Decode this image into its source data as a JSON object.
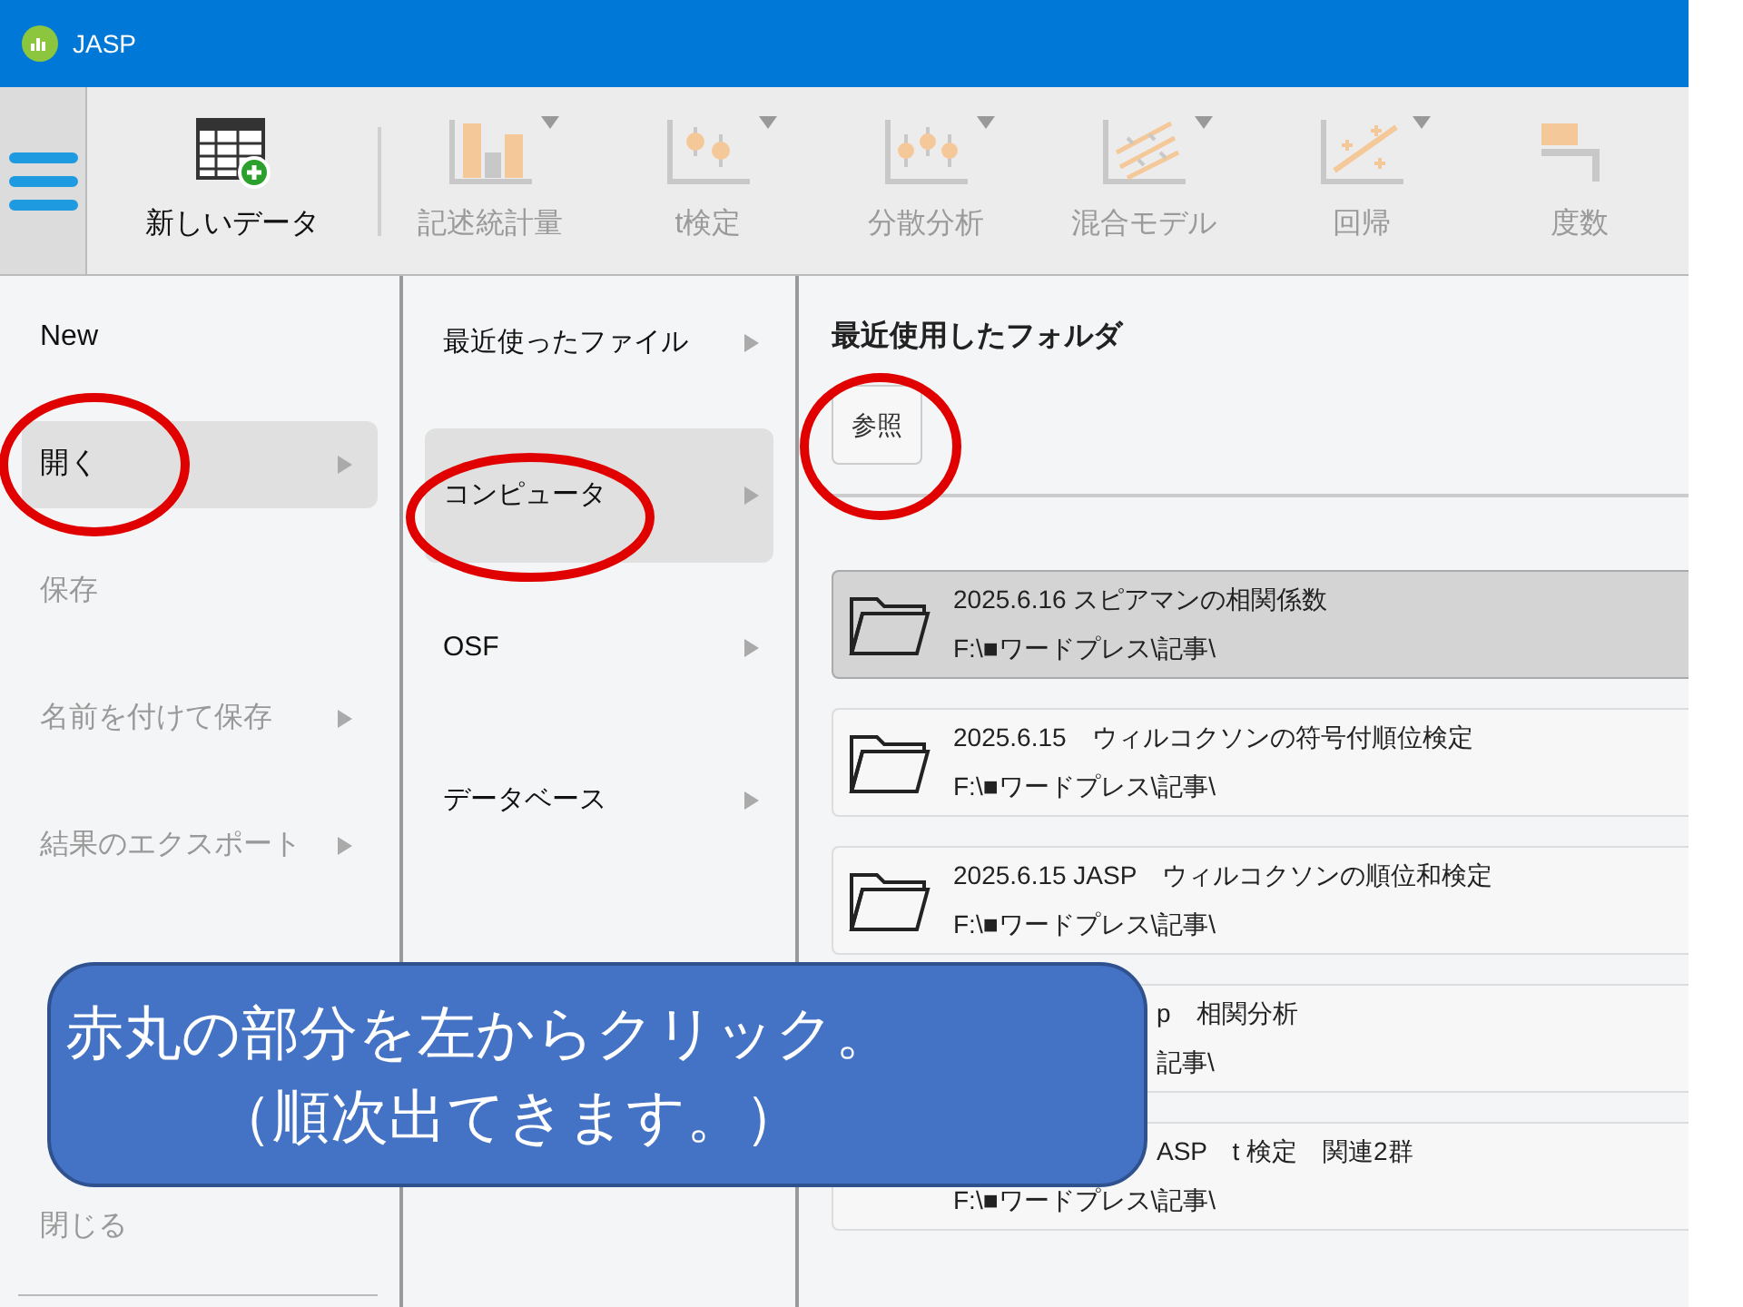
{
  "window": {
    "title": "JASP"
  },
  "toolbar": [
    {
      "label": "新しいデータ",
      "kind": "new",
      "disabled": false,
      "dropdown": false
    },
    {
      "label": "記述統計量",
      "kind": "bars",
      "disabled": true,
      "dropdown": true
    },
    {
      "label": "t検定",
      "kind": "ttest",
      "disabled": true,
      "dropdown": true
    },
    {
      "label": "分散分析",
      "kind": "anova",
      "disabled": true,
      "dropdown": true
    },
    {
      "label": "混合モデル",
      "kind": "mixed",
      "disabled": true,
      "dropdown": true
    },
    {
      "label": "回帰",
      "kind": "regression",
      "disabled": true,
      "dropdown": true
    },
    {
      "label": "度数",
      "kind": "freq",
      "disabled": true,
      "dropdown": false
    }
  ],
  "file_menu": [
    {
      "label": "New",
      "disabled": false,
      "submenu": false,
      "selected": false
    },
    {
      "label": "開く",
      "disabled": false,
      "submenu": true,
      "selected": true
    },
    {
      "label": "保存",
      "disabled": true,
      "submenu": false,
      "selected": false
    },
    {
      "label": "名前を付けて保存",
      "disabled": true,
      "submenu": true,
      "selected": false
    },
    {
      "label": "結果のエクスポート",
      "disabled": true,
      "submenu": true,
      "selected": false
    },
    {
      "label": "閉じる",
      "disabled": true,
      "submenu": false,
      "selected": false
    }
  ],
  "open_menu": [
    {
      "label": "最近使ったファイル",
      "selected": false
    },
    {
      "label": "コンピュータ",
      "selected": true
    },
    {
      "label": "OSF",
      "selected": false
    },
    {
      "label": "データベース",
      "selected": false
    }
  ],
  "folders": {
    "heading": "最近使用したフォルダ",
    "browse_button": "参照",
    "items": [
      {
        "kind": "full",
        "title": "2025.6.16 スピアマンの相関係数",
        "path": "F:\\■ワードプレス\\記事\\",
        "selected": true
      },
      {
        "kind": "full",
        "title": "2025.6.15　ウィルコクソンの符号付順位検定",
        "path": "F:\\■ワードプレス\\記事\\",
        "selected": false
      },
      {
        "kind": "full",
        "title": "2025.6.15 JASP　ウィルコクソンの順位和検定",
        "path": "F:\\■ワードプレス\\記事\\",
        "selected": false
      },
      {
        "kind": "both_covered",
        "title": "p　相関分析",
        "path": "記事\\",
        "selected": false
      },
      {
        "kind": "title_covered",
        "title": "ASP　t 検定　関連2群",
        "path": "F:\\■ワードプレス\\記事\\",
        "selected": false
      }
    ]
  },
  "callout": {
    "lines": [
      "赤丸の部分を左からクリック。",
      "（順次出てきます。）"
    ]
  }
}
